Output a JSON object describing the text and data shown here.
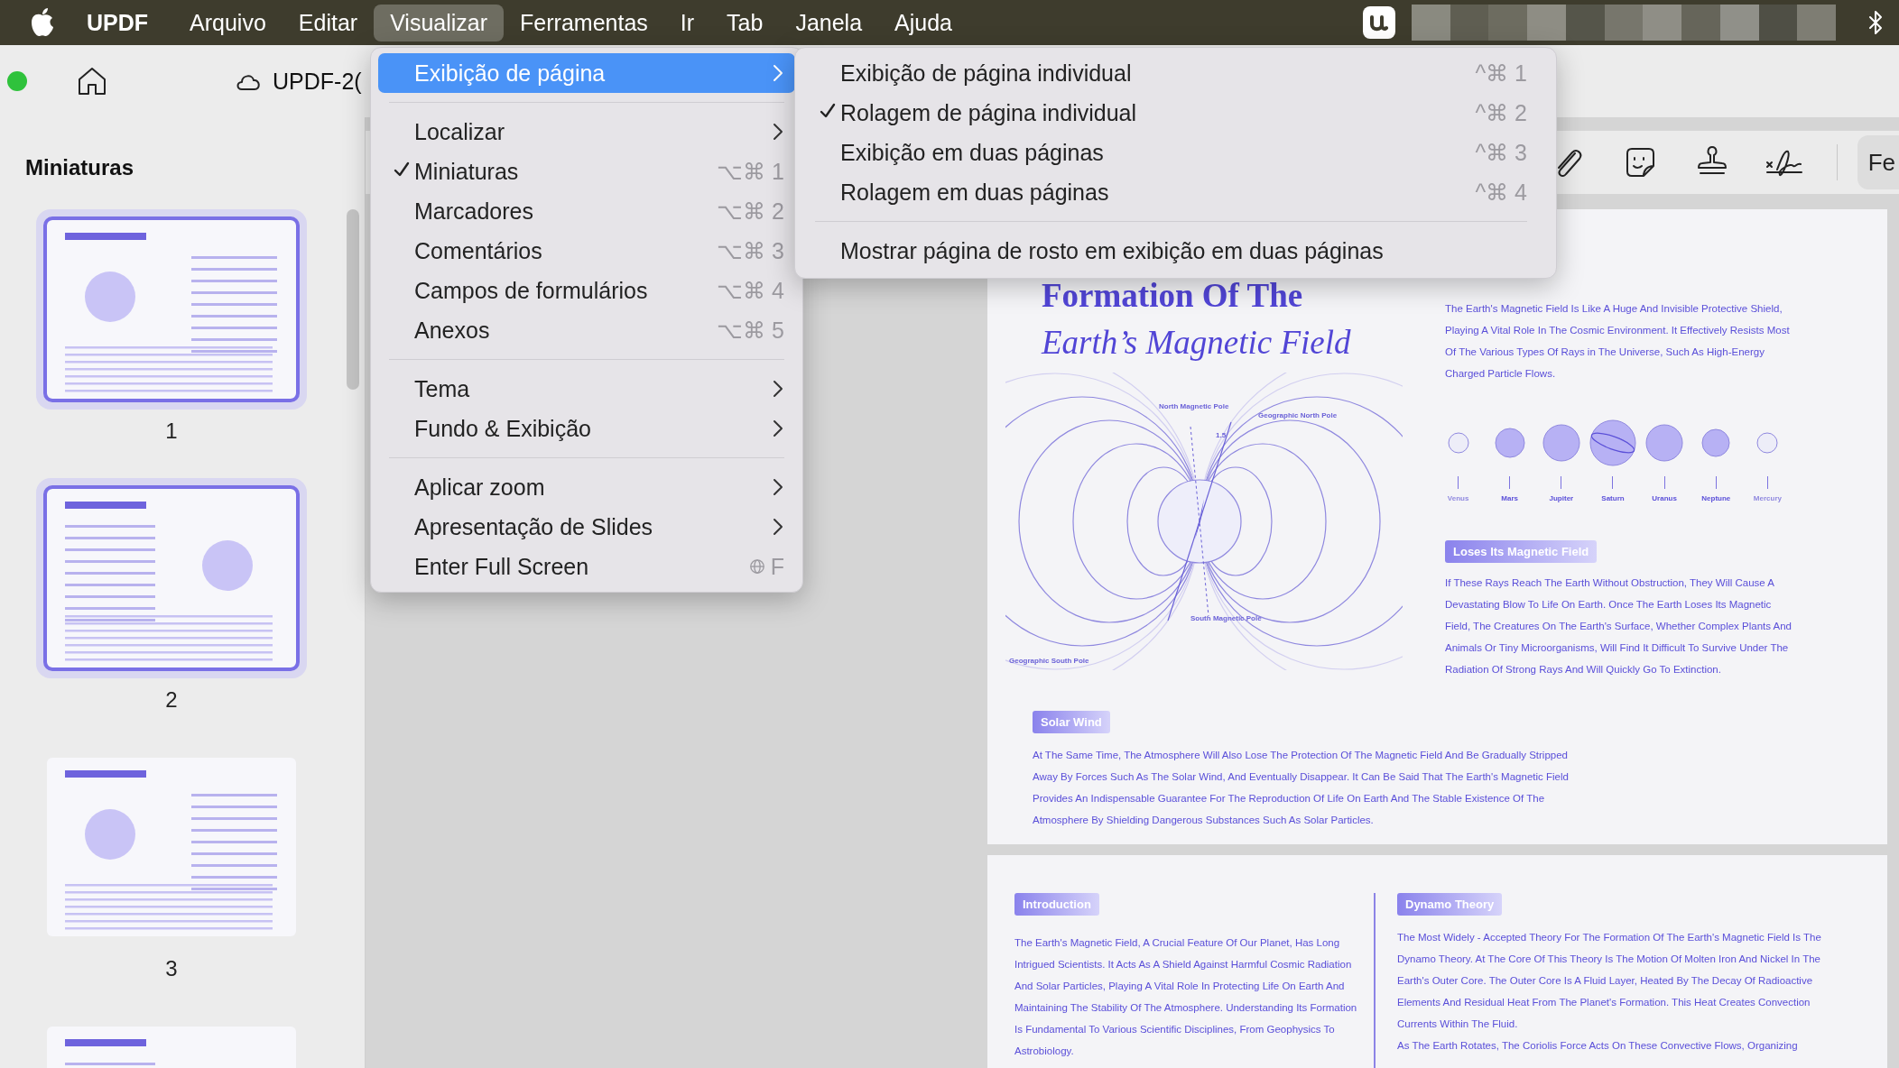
{
  "menubar": {
    "app_name": "UPDF",
    "items": [
      {
        "label": "Arquivo",
        "selected": false
      },
      {
        "label": "Editar",
        "selected": false
      },
      {
        "label": "Visualizar",
        "selected": true
      },
      {
        "label": "Ferramentas",
        "selected": false
      },
      {
        "label": "Ir",
        "selected": false
      },
      {
        "label": "Tab",
        "selected": false
      },
      {
        "label": "Janela",
        "selected": false
      },
      {
        "label": "Ajuda",
        "selected": false
      }
    ]
  },
  "toolbar": {
    "document_title": "UPDF-2("
  },
  "sidebar": {
    "title": "Miniaturas",
    "thumbnails": [
      {
        "label": "1",
        "selected": true
      },
      {
        "label": "2",
        "selected": true
      },
      {
        "label": "3",
        "selected": false
      },
      {
        "selected": false
      }
    ]
  },
  "annotation_toolbar": {
    "button": "Fe"
  },
  "view_menu": [
    {
      "kind": "submenu",
      "label": "Exibição de página",
      "selected": true,
      "checked": false
    },
    {
      "kind": "separator"
    },
    {
      "kind": "submenu",
      "label": "Localizar",
      "selected": false,
      "checked": false
    },
    {
      "kind": "command",
      "label": "Miniaturas",
      "selected": false,
      "checked": true,
      "shortcut": "⌥⌘ 1"
    },
    {
      "kind": "command",
      "label": "Marcadores",
      "selected": false,
      "checked": false,
      "shortcut": "⌥⌘ 2"
    },
    {
      "kind": "command",
      "label": "Comentários",
      "selected": false,
      "checked": false,
      "shortcut": "⌥⌘ 3"
    },
    {
      "kind": "command",
      "label": "Campos de formulários",
      "selected": false,
      "checked": false,
      "shortcut": "⌥⌘ 4"
    },
    {
      "kind": "command",
      "label": "Anexos",
      "selected": false,
      "checked": false,
      "shortcut": "⌥⌘ 5"
    },
    {
      "kind": "separator"
    },
    {
      "kind": "submenu",
      "label": "Tema",
      "selected": false,
      "checked": false
    },
    {
      "kind": "submenu",
      "label": "Fundo & Exibição",
      "selected": false,
      "checked": false
    },
    {
      "kind": "separator"
    },
    {
      "kind": "submenu",
      "label": "Aplicar zoom",
      "selected": false,
      "checked": false
    },
    {
      "kind": "submenu",
      "label": "Apresentação de Slides",
      "selected": false,
      "checked": false
    },
    {
      "kind": "command",
      "label": "Enter Full Screen",
      "selected": false,
      "checked": false,
      "shortcut": "F",
      "shortcut_globe": true
    }
  ],
  "page_display_submenu": [
    {
      "kind": "command",
      "label": "Exibição de página individual",
      "checked": false,
      "shortcut": "^⌘ 1"
    },
    {
      "kind": "command",
      "label": "Rolagem de página individual",
      "checked": true,
      "shortcut": "^⌘ 2"
    },
    {
      "kind": "command",
      "label": "Exibição em duas páginas",
      "checked": false,
      "shortcut": "^⌘ 3"
    },
    {
      "kind": "command",
      "label": "Rolagem em duas páginas",
      "checked": false,
      "shortcut": "^⌘ 4"
    },
    {
      "kind": "separator"
    },
    {
      "kind": "command",
      "label": "Mostrar página de rosto em exibição em duas páginas",
      "checked": false
    }
  ],
  "page_1": {
    "title_line_1": "Formation Of The",
    "title_line_2": "Earth’s Magnetic Field",
    "intro_paragraph": "The Earth's Magnetic Field Is Like A Huge And Invisible Protective Shield, Playing A Vital Role In The Cosmic Environment. It Effectively Resists Most Of The Various Types Of Rays in The Universe, Such As High-Energy Charged Particle Flows.",
    "diagram_labels": {
      "north_magnetic": "North Magnetic Pole",
      "geographic_north": "Geographic North Pole",
      "angle": "1.5",
      "geographic_south": "Geographic South Pole",
      "south_magnetic": "South Magnetic Pole"
    },
    "planets": [
      "Venus",
      "Mars",
      "Jupiter",
      "Saturn",
      "Uranus",
      "Neptune",
      "Mercury"
    ],
    "sections": [
      {
        "heading": "Loses Its Magnetic Field",
        "text": "If These Rays Reach The Earth Without Obstruction, They Will Cause A Devastating Blow To Life On Earth. Once The Earth Loses Its Magnetic Field, The Creatures On The Earth's Surface, Whether Complex Plants And Animals Or Tiny Microorganisms, Will Find It Difficult To Survive Under The Radiation Of Strong Rays And Will Quickly Go To Extinction."
      },
      {
        "heading": "Solar Wind",
        "text": "At The Same Time, The Atmosphere Will Also Lose The Protection Of The Magnetic Field And Be Gradually Stripped Away By Forces Such As The Solar Wind, And Eventually Disappear. It Can Be Said That The Earth's Magnetic Field Provides An Indispensable Guarantee For The Reproduction Of Life On Earth And The Stable Existence Of The Atmosphere By Shielding Dangerous Substances Such As Solar Particles."
      }
    ]
  },
  "page_2": {
    "columns": [
      {
        "heading": "Introduction",
        "paragraphs": [
          "The Earth's Magnetic Field, A Crucial Feature Of Our Planet, Has Long Intrigued Scientists. It Acts As A Shield Against Harmful Cosmic Radiation And Solar Particles, Playing A Vital Role In Protecting Life On Earth And Maintaining The Stability Of The Atmosphere. Understanding Its Formation Is Fundamental To Various Scientific Disciplines, From Geophysics To Astrobiology."
        ]
      },
      {
        "heading": "Dynamo Theory",
        "paragraphs": [
          "The Most Widely - Accepted Theory For The Formation Of The Earth's Magnetic Field Is The Dynamo Theory. At The Core Of This Theory Is The Motion Of Molten Iron And Nickel In The Earth's Outer Core. The Outer Core Is A Fluid Layer, Heated By The Decay Of Radioactive Elements And Residual Heat From The Planet's Formation. This Heat Creates Convection Currents Within The Fluid.",
          "As The Earth Rotates, The Coriolis Force Acts On These Convective Flows, Organizing"
        ]
      }
    ]
  }
}
